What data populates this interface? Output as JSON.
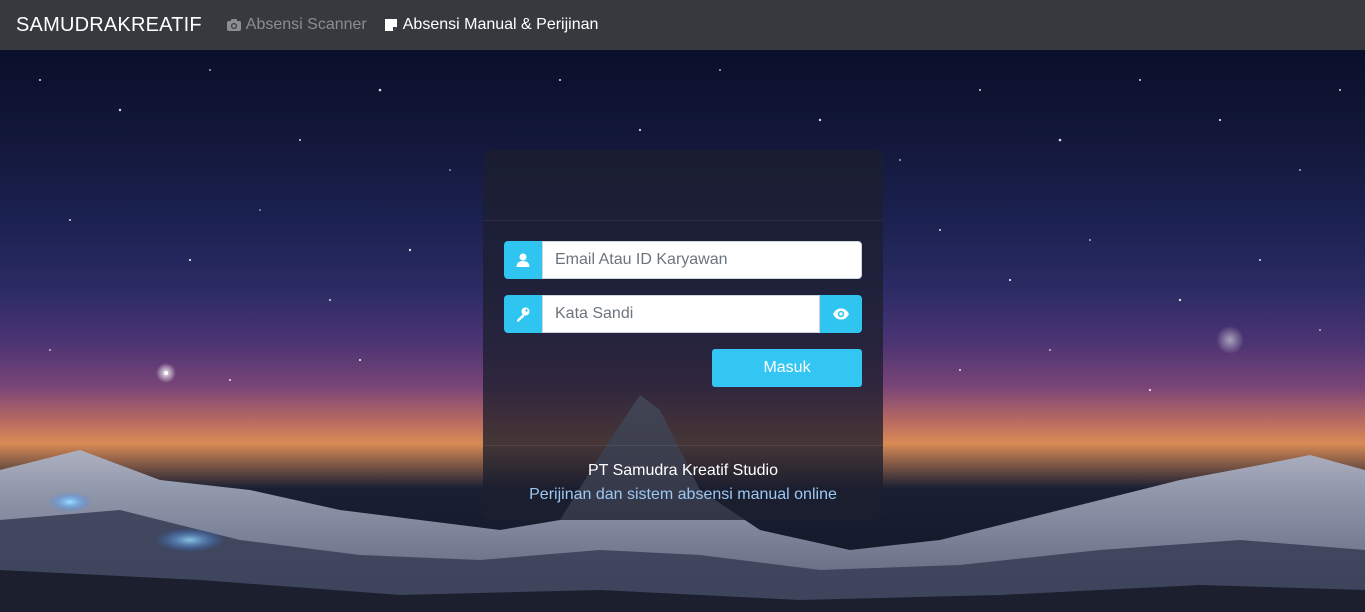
{
  "navbar": {
    "brand": "SAMUDRAKREATIF",
    "links": [
      {
        "label": "Absensi Scanner",
        "icon": "camera-icon",
        "state": "muted"
      },
      {
        "label": "Absensi Manual & Perijinan",
        "icon": "note-icon",
        "state": "active"
      }
    ]
  },
  "login": {
    "email_placeholder": "Email Atau ID Karyawan",
    "email_icon": "user-icon",
    "password_placeholder": "Kata Sandi",
    "password_icon": "key-icon",
    "toggle_icon": "eye-icon",
    "submit_label": "Masuk"
  },
  "footer": {
    "company": "PT Samudra Kreatif Studio",
    "tagline": "Perijinan dan sistem absensi manual online"
  },
  "colors": {
    "navbar_bg": "#363a3f",
    "accent": "#2fc5f0",
    "tagline": "#9cc8f2"
  }
}
